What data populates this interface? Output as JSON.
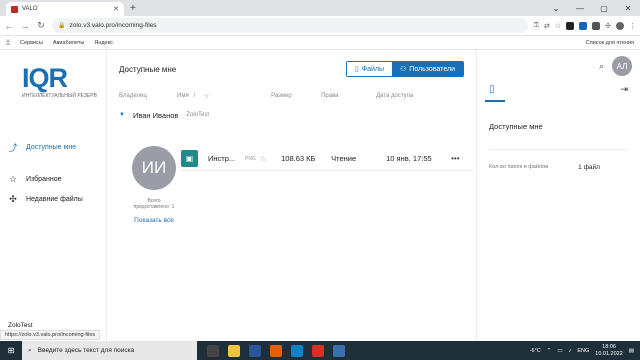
{
  "browser": {
    "tab_title": "VALO",
    "url": "zolo.v3.valo.pro/incoming-files",
    "bookmarks": [
      "Сервисы",
      "Авиабилеты",
      "Яндекс"
    ],
    "reading_list": "Список для чтения"
  },
  "app": {
    "logo": "IQR",
    "logo_sub": "ИНТЕЛЛЕКТУАЛЬНЫЙ РЕЗЕРВ",
    "sidebar": {
      "items": [
        {
          "label": "Доступные мне",
          "icon": "share-icon",
          "active": true
        },
        {
          "label": "Избранное",
          "icon": "star-icon",
          "active": false
        },
        {
          "label": "Недавние файлы",
          "icon": "pin-icon",
          "active": false
        }
      ],
      "workspace": "ZoloTest"
    },
    "main": {
      "title": "Доступные мне",
      "toggle": {
        "files": "Файлы",
        "users": "Пользователи"
      },
      "columns": {
        "owner": "Владелец",
        "name": "Имя",
        "size": "Размер",
        "rights": "Права",
        "date": "Дата доступа"
      },
      "group": {
        "name": "Иван Иванов",
        "sub": "ZoloTest"
      },
      "owner_card": {
        "initials": "ИИ",
        "meta_line1": "Всего",
        "meta_line2": "предоставлено: 1",
        "show_all": "Показать все"
      },
      "file": {
        "name": "Инстр...",
        "ext": "PNG",
        "size": "108.63 КБ",
        "rights": "Чтение",
        "date": "10 янв, 17:55"
      }
    },
    "panel": {
      "title": "Доступные мне",
      "key": "Кол-во папок и файлов",
      "value": "1 файл"
    },
    "user_initials": "АЛ"
  },
  "status_url": "https://zolo.v3.valo.pro/incoming-files",
  "taskbar": {
    "search_placeholder": "Введите здесь текст для поиска",
    "weather": "-6°C",
    "lang": "ENG",
    "time": "18:06",
    "date": "10.01.2022"
  }
}
